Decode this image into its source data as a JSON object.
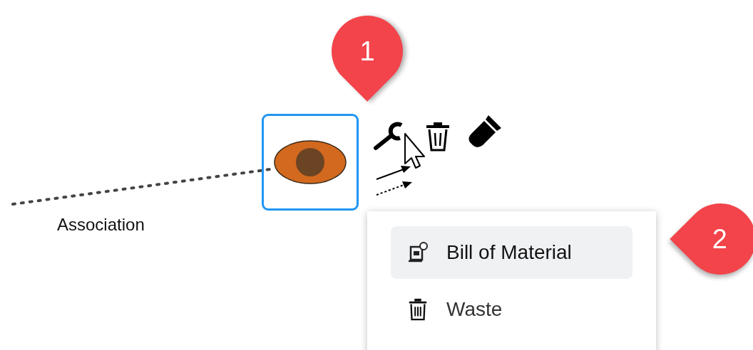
{
  "canvas": {
    "connector": {
      "label": "Association"
    },
    "node": {
      "selected": true
    },
    "tools": [
      {
        "kind": "wrench"
      },
      {
        "kind": "trash"
      },
      {
        "kind": "brush"
      },
      {
        "kind": "arrows"
      }
    ],
    "menu": {
      "items": [
        {
          "label": "Bill of Material",
          "selected": true,
          "kind": "bom"
        },
        {
          "label": "Waste",
          "selected": false,
          "kind": "trash"
        }
      ]
    },
    "callouts": [
      {
        "number": "1",
        "kind": "down"
      },
      {
        "number": "2",
        "kind": "left"
      }
    ]
  }
}
